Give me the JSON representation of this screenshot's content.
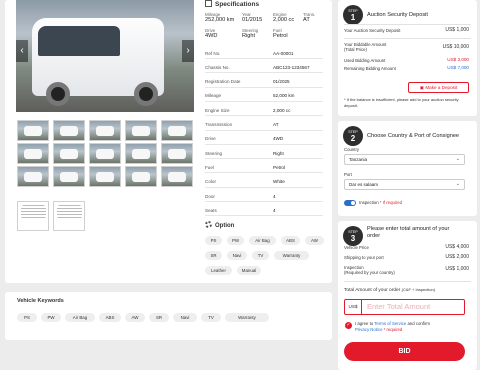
{
  "specs": {
    "title": "Specifications",
    "quick": [
      {
        "label": "Mileage",
        "value": "252,000 km"
      },
      {
        "label": "Year",
        "value": "01/2015"
      },
      {
        "label": "Engine",
        "value": "2,000 cc"
      },
      {
        "label": "Trans.",
        "value": "AT"
      },
      {
        "label": "Drive",
        "value": "4WD"
      },
      {
        "label": "Steering",
        "value": "Right"
      },
      {
        "label": "Fuel",
        "value": "Petrol"
      }
    ],
    "rows": [
      {
        "label": "Ref No.",
        "value": "AA-00001"
      },
      {
        "label": "Chassis No.",
        "value": "ABC123-1234567"
      },
      {
        "label": "Registration Date",
        "value": "01/2025"
      },
      {
        "label": "Mileage",
        "value": "52,000 km"
      },
      {
        "label": "Engine Size",
        "value": "2,000 cc"
      },
      {
        "label": "Transmission",
        "value": "AT"
      },
      {
        "label": "Drive",
        "value": "4WD"
      },
      {
        "label": "Steering",
        "value": "Right"
      },
      {
        "label": "Fuel",
        "value": "Petrol"
      },
      {
        "label": "Color",
        "value": "White"
      },
      {
        "label": "Door",
        "value": "4"
      },
      {
        "label": "Seats",
        "value": "4"
      }
    ]
  },
  "gallery": {
    "prev_icon": "‹",
    "next_icon": "›"
  },
  "options": {
    "title": "Option",
    "items": [
      "PS",
      "PW",
      "Air Bag",
      "ABS",
      "AW",
      "SR",
      "Navi",
      "TV",
      "Warranty",
      "Leather",
      "Manual"
    ]
  },
  "keywords": {
    "title": "Vehicle Keywords",
    "items": [
      "PS",
      "PW",
      "Air Bag",
      "ABS",
      "AW",
      "SR",
      "Navi",
      "TV",
      "Warranty"
    ]
  },
  "step1": {
    "step_label": "STEP",
    "step_num": "1",
    "title": "Auction Security Deposit",
    "deposit_label": "Your Auction Security Deposit",
    "deposit_value": "US$ 1,000",
    "bidding_label": "Your Biddable Amount",
    "bidding_sub": "(Total Price)",
    "bidding_value": "US$ 10,000",
    "used_label": "Used Bidding Amount",
    "used_value": "US$ 3,000",
    "remaining_label": "Remaining Bidding Amount",
    "remaining_value": "US$ 7,000",
    "button": "Make a Deposit",
    "note": "* If the balance is insufficient, please add to your auction security deposit."
  },
  "step2": {
    "step_label": "STEP",
    "step_num": "2",
    "title": "Choose Country & Port of Consignee",
    "country_label": "Country",
    "country_value": "Tanzania",
    "port_label": "Port",
    "port_value": "Dar es salaam",
    "inspection_label": "Inspection",
    "inspection_required": "* If required"
  },
  "step3": {
    "step_label": "STEP",
    "step_num": "3",
    "title_line1": "Please enter total amount of your",
    "title_line2": "order",
    "price_label": "Vehicle Price",
    "price_value": "US$ 4,000",
    "ship_label": "Shipping to your port",
    "ship_value": "US$ 2,000",
    "insp_label": "Inspection",
    "insp_sub": "(Required by your country)",
    "insp_value": "US$ 1,000",
    "total_label": "Total Amount of your order",
    "total_sub": "(C&F + Inspection)",
    "currency": "US$",
    "total_placeholder": "Enter Total Amount",
    "agree_prefix": "I agree to ",
    "terms": "Terms of Service",
    "agree_mid": " and confirm",
    "privacy": "Privacy Notice",
    "required": "* required",
    "bid_button": "BID"
  },
  "colors": {
    "accent": "#e21a2c",
    "link": "#2a6fc9"
  }
}
